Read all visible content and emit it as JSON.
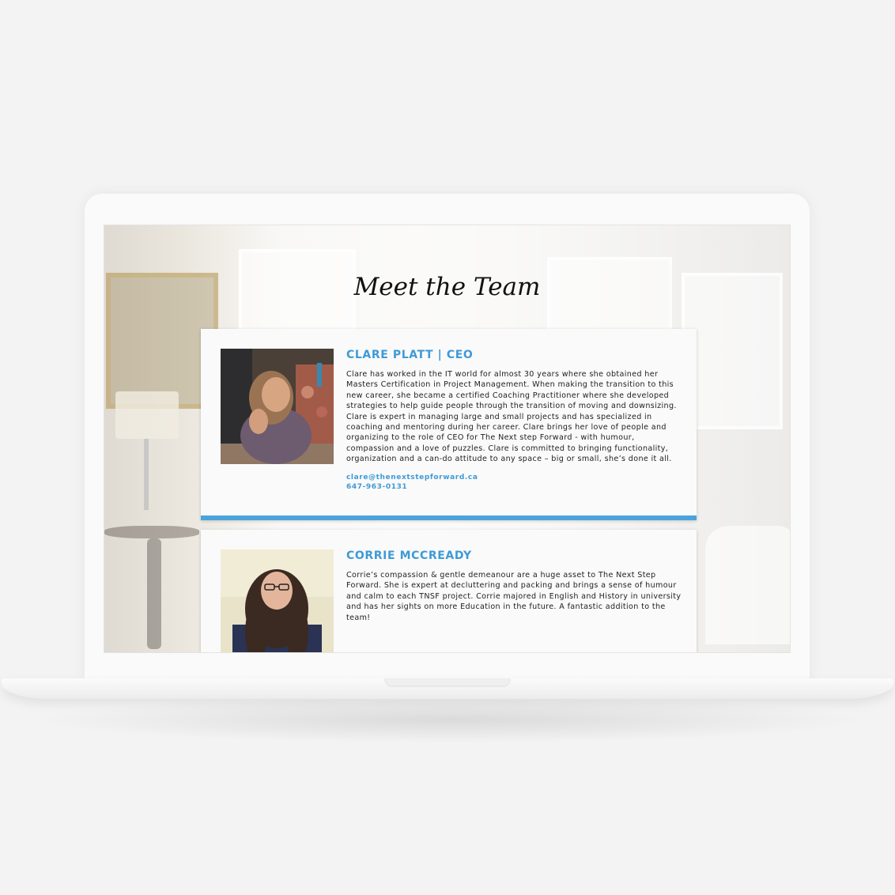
{
  "page": {
    "title": "Meet the Team"
  },
  "team": [
    {
      "name": "CLARE PLATT | CEO",
      "bio": "Clare has worked in the IT world for almost 30 years where she obtained her Masters Certification in Project Management. When making the transition to this new career, she became a certified Coaching Practitioner where she developed strategies to help guide people through the transition of moving and downsizing. Clare is expert in managing large and small projects and has specialized in coaching and mentoring during her career. Clare brings her love of people and organizing to the role of CEO for The Next step Forward - with humour, compassion and a love of puzzles. Clare is committed to bringing functionality, organization and a can-do attitude to any space – big or small, she’s done it all.",
      "email": "clare@thenextstepforward.ca",
      "phone": "647-963-0131"
    },
    {
      "name": "CORRIE MCCREADY",
      "bio": "Corrie’s compassion & gentle demeanour are a huge asset to The Next Step Forward. She is expert at decluttering and packing and brings a sense of humour and calm to each TNSF project. Corrie majored in English and History in university and has her sights on more Education in the future. A fantastic addition to the team!"
    }
  ],
  "colors": {
    "accent": "#3f9ad6",
    "card_bar": "#4aa3dc",
    "page_background": "#f3f3f3"
  }
}
